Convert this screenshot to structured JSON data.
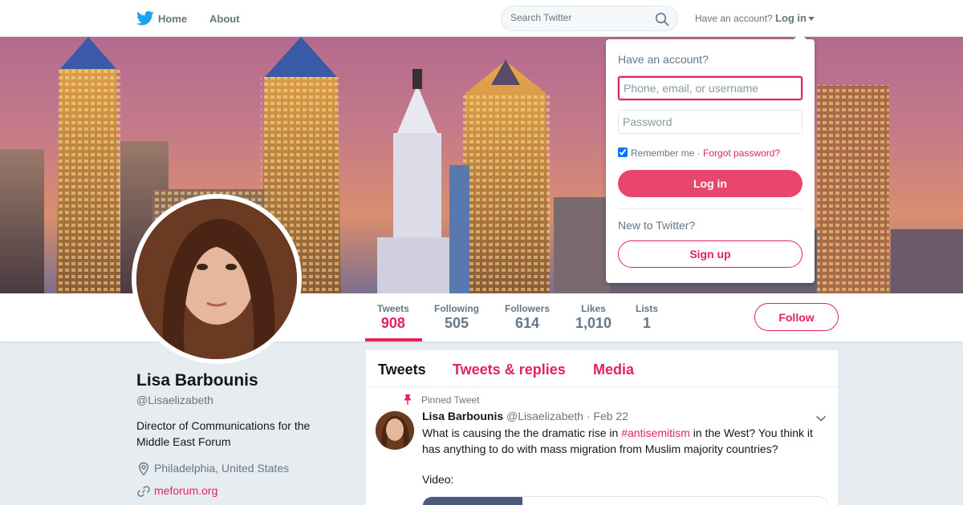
{
  "nav": {
    "home_label": "Home",
    "about_label": "About",
    "search_placeholder": "Search Twitter",
    "have_account_text": "Have an account?",
    "login_label": "Log in"
  },
  "profile_nav": {
    "stats": [
      {
        "label": "Tweets",
        "value": "908"
      },
      {
        "label": "Following",
        "value": "505"
      },
      {
        "label": "Followers",
        "value": "614"
      },
      {
        "label": "Likes",
        "value": "1,010"
      },
      {
        "label": "Lists",
        "value": "1"
      }
    ],
    "follow_label": "Follow"
  },
  "profile": {
    "name": "Lisa Barbounis",
    "handle": "@Lisaelizabeth",
    "bio": "Director of Communications for the Middle East Forum",
    "location": "Philadelphia, United States",
    "url": "meforum.org"
  },
  "timeline": {
    "tabs": [
      "Tweets",
      "Tweets & replies",
      "Media"
    ],
    "pinned_label": "Pinned Tweet",
    "tweet": {
      "name": "Lisa Barbounis",
      "handle": "@Lisaelizabeth",
      "separator": "·",
      "date": "Feb 22",
      "text_before": "What is causing the the dramatic rise in ",
      "hashtag": "#antisemitism",
      "text_after": " in the West?  You think it has anything to do with mass migration from Muslim majority countries?",
      "video_label": "Video:"
    }
  },
  "login_dropdown": {
    "title": "Have an account?",
    "username_placeholder": "Phone, email, or username",
    "password_placeholder": "Password",
    "remember_label": "Remember me ·",
    "forgot_label": "Forgot password?",
    "login_button": "Log in",
    "new_text": "New to Twitter?",
    "signup_button": "Sign up"
  },
  "colors": {
    "accent": "#e0245e",
    "login_button_bg": "#e8466c",
    "muted_text": "#657786",
    "twitter_blue": "#1da1f2"
  },
  "icons": [
    "twitter-bird-icon",
    "search-icon",
    "caret-down-icon",
    "location-pin-icon",
    "link-icon",
    "pin-icon",
    "chevron-down-icon"
  ]
}
